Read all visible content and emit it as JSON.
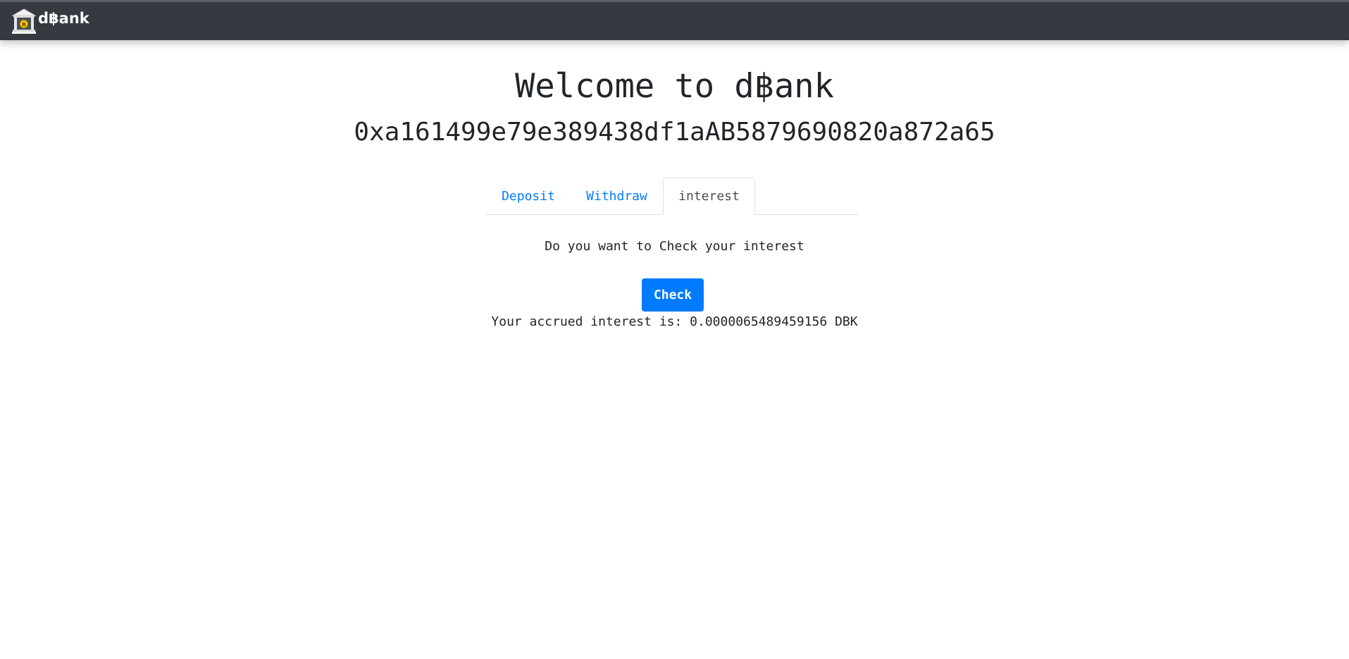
{
  "navbar": {
    "brand_text": "d฿ank",
    "logo_icon": "bank-icon"
  },
  "main": {
    "title": "Welcome to d฿ank",
    "account": "0xa161499e79e389438df1aAB5879690820a872a65",
    "tabs": [
      {
        "label": "Deposit",
        "active": false
      },
      {
        "label": "Withdraw",
        "active": false
      },
      {
        "label": "interest",
        "active": true
      }
    ],
    "interest": {
      "prompt": "Do you want to Check your interest",
      "button_label": "Check",
      "result": "Your accrued interest is: 0.0000065489459156 DBK"
    }
  },
  "colors": {
    "navbar_bg": "#343a40",
    "link": "#007bff",
    "button_bg": "#007bff",
    "text": "#212529"
  }
}
